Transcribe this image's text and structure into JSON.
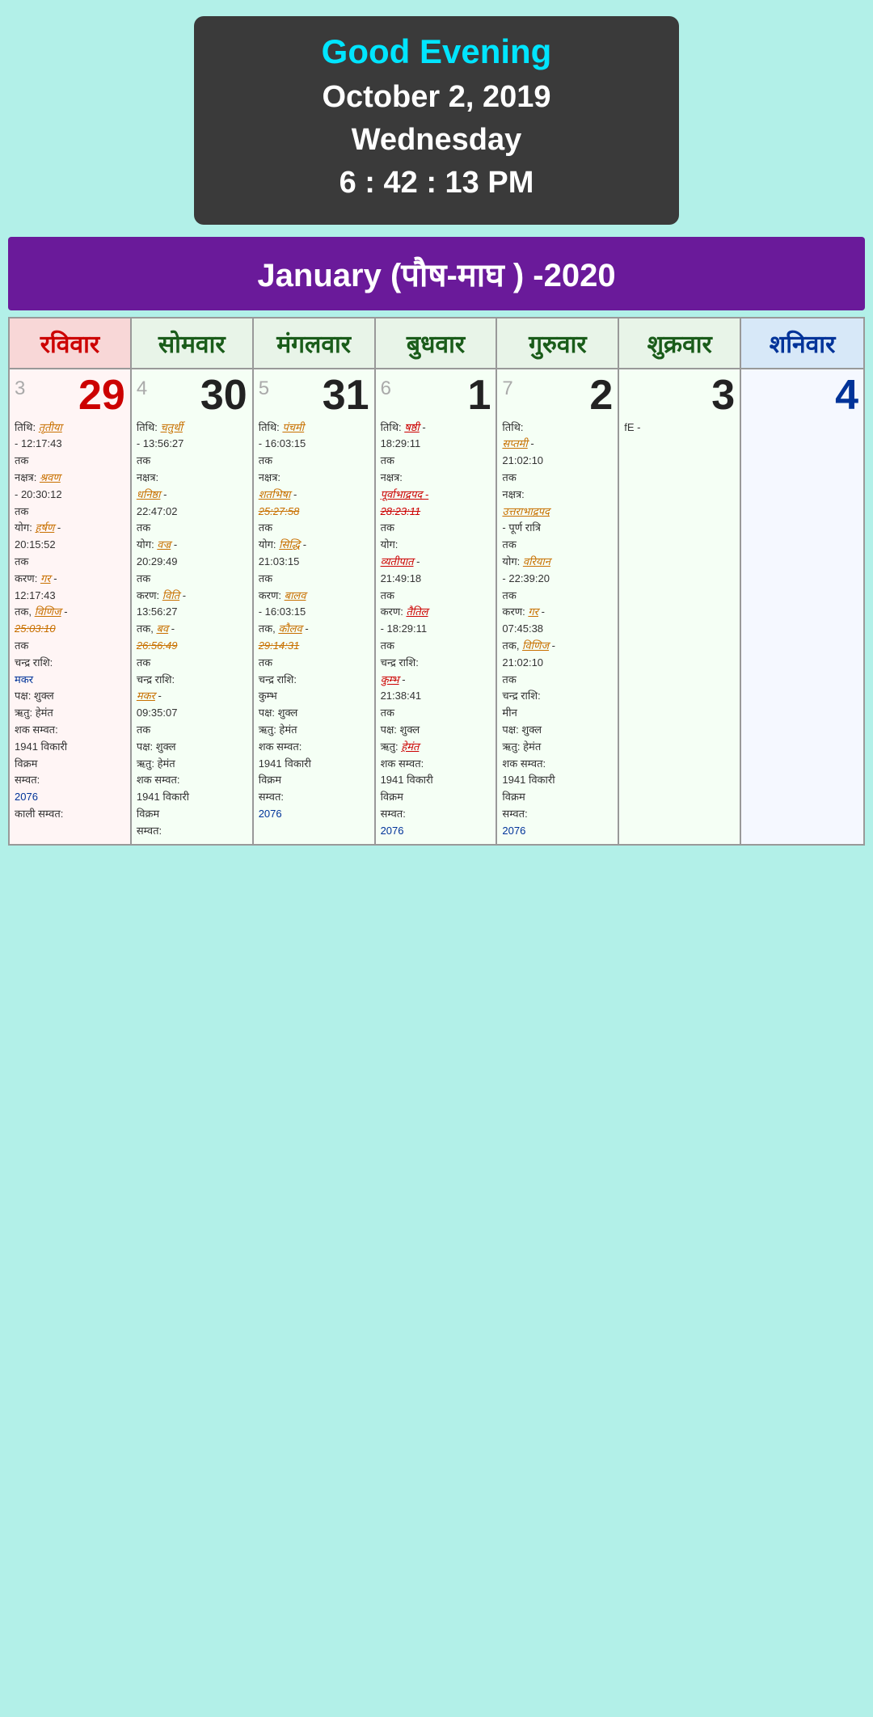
{
  "header": {
    "greeting": "Good Evening",
    "date": "October 2, 2019",
    "day": "Wednesday",
    "time": "6 : 42 : 13 PM"
  },
  "calendar": {
    "month_title": "January (पौष-माघ ) -2020",
    "day_headers": [
      {
        "label": "रविवार",
        "type": "sunday"
      },
      {
        "label": "सोमवार",
        "type": "weekday"
      },
      {
        "label": "मंगलवार",
        "type": "weekday"
      },
      {
        "label": "बुधवार",
        "type": "weekday"
      },
      {
        "label": "गुरुवार",
        "type": "weekday"
      },
      {
        "label": "शुक्रवार",
        "type": "saturday"
      },
      {
        "label": "शनिवार",
        "type": "saturday"
      }
    ]
  }
}
